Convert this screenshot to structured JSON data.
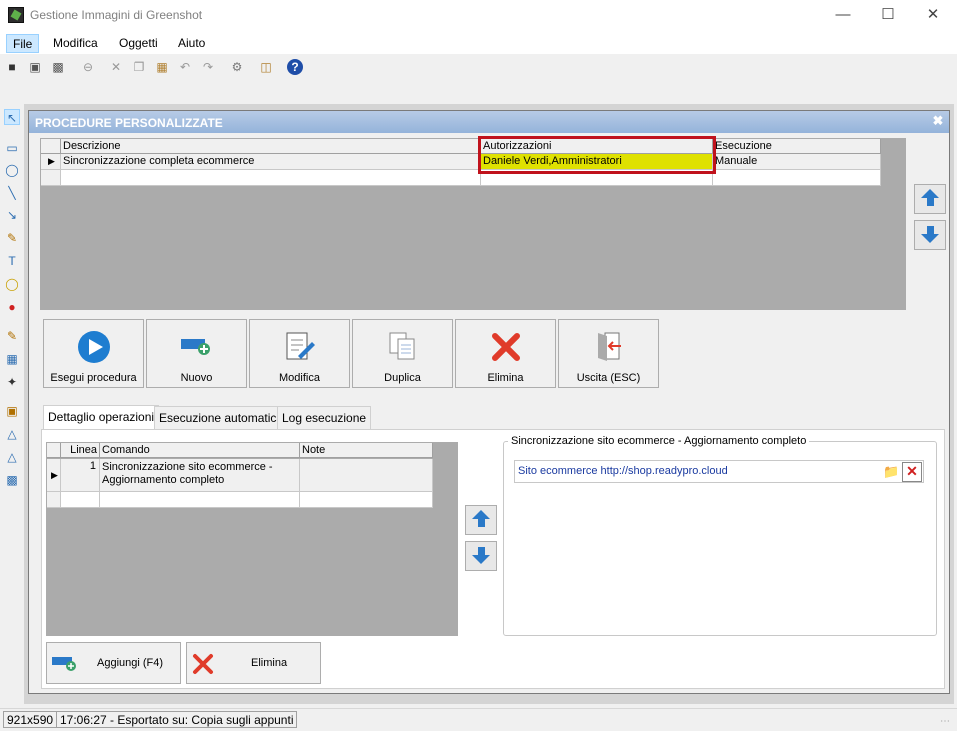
{
  "window": {
    "title": "Gestione Immagini di Greenshot",
    "minimize": "—",
    "maximize": "☐",
    "close": "✕"
  },
  "menu": {
    "file": "File",
    "edit": "Modifica",
    "objects": "Oggetti",
    "help": "Aiuto"
  },
  "dialog": {
    "title": "PROCEDURE PERSONALIZZATE",
    "close_glyph": "✖",
    "procedures": {
      "headers": [
        "Descrizione",
        "Autorizzazioni",
        "Esecuzione"
      ],
      "rows": [
        {
          "description": "Sincronizzazione completa ecommerce",
          "authorizations": "Daniele Verdi,Amministratori",
          "execution": "Manuale"
        }
      ]
    },
    "actions": {
      "run": "Esegui procedura",
      "new": "Nuovo",
      "edit": "Modifica",
      "duplicate": "Duplica",
      "delete": "Elimina",
      "exit": "Uscita (ESC)"
    },
    "tabs": [
      "Dettaglio operazioni",
      "Esecuzione automatica",
      "Log esecuzione"
    ],
    "operations": {
      "headers": [
        "Linea",
        "Comando",
        "Note"
      ],
      "rows": [
        {
          "line": "1",
          "command": "Sincronizzazione sito ecommerce - Aggiornamento completo",
          "note": ""
        }
      ]
    },
    "detail": {
      "title": "Sincronizzazione sito ecommerce - Aggiornamento completo",
      "site": "Sito ecommerce http://shop.readypro.cloud"
    },
    "bottom_buttons": {
      "add": "Aggiungi (F4)",
      "delete": "Elimina"
    }
  },
  "status": {
    "size": "921x590",
    "message": "17:06:27 - Esportato su: Copia sugli appunti"
  },
  "colors": {
    "highlight": "#dfe100",
    "accent_blue": "#2a79c8",
    "red_frame": "#c0121c"
  }
}
